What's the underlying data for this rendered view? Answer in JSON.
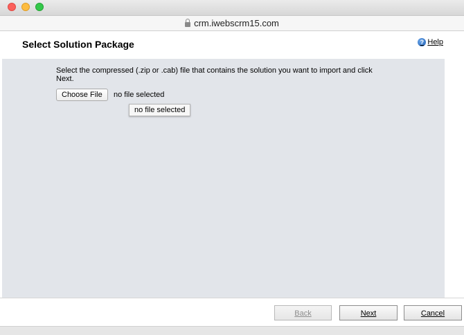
{
  "window": {
    "address": "crm.iwebscrm15.com"
  },
  "header": {
    "title": "Select Solution Package",
    "help_label": "Help",
    "help_icon": "?"
  },
  "main": {
    "instructions": "Select the compressed (.zip or .cab) file that contains the solution you want to import and click Next.",
    "choose_file_label": "Choose File",
    "file_status": "no file selected",
    "tooltip": "no file selected"
  },
  "footer": {
    "back_label": "Back",
    "next_label": "Next",
    "cancel_label": "Cancel"
  },
  "colors": {
    "content_background": "#e2e5ea",
    "help_icon": "#1e5fb4",
    "traffic_red": "#fc605c",
    "traffic_yellow": "#fdbc40",
    "traffic_green": "#34c84a"
  }
}
